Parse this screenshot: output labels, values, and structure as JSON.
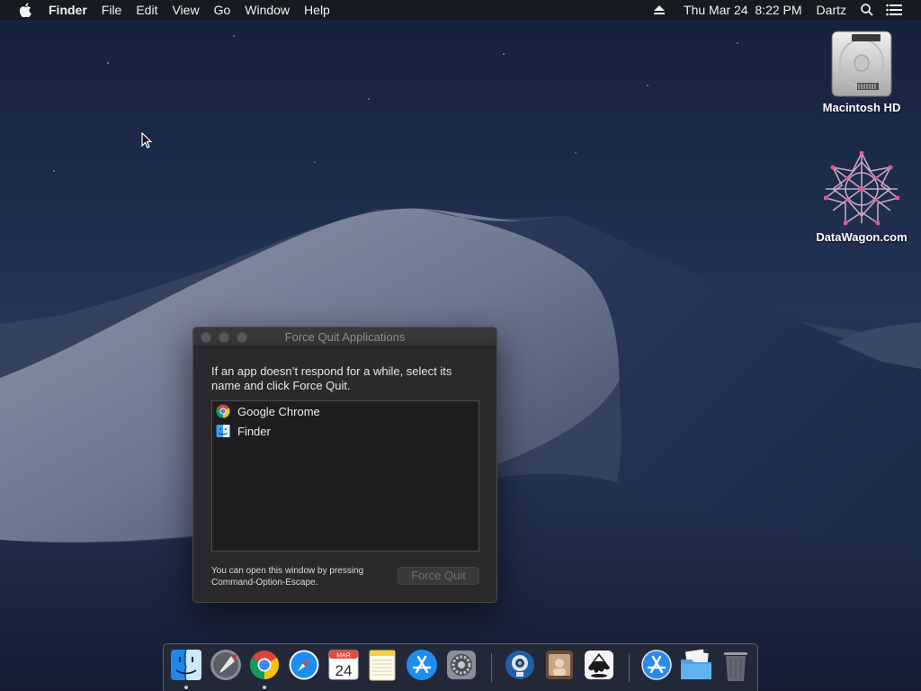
{
  "menubar": {
    "apple_icon": "apple-logo-icon",
    "app_name": "Finder",
    "menus": [
      "File",
      "Edit",
      "View",
      "Go",
      "Window",
      "Help"
    ],
    "status": {
      "eject_icon": "eject-icon",
      "clock": "Thu Mar 24  8:22 PM",
      "user": "Dartz",
      "spotlight_icon": "search-icon",
      "notification_icon": "list-icon"
    }
  },
  "desktop": {
    "icons": [
      {
        "label": "Macintosh HD",
        "icon": "hard-drive-icon"
      },
      {
        "label": "DataWagon.com",
        "icon": "star-polygon-icon"
      }
    ]
  },
  "force_quit": {
    "title": "Force Quit Applications",
    "message": "If an app doesn’t respond for a while, select its name and click Force Quit.",
    "apps": [
      {
        "name": "Google Chrome",
        "icon": "chrome-icon"
      },
      {
        "name": "Finder",
        "icon": "finder-icon"
      }
    ],
    "hint": "You can open this window by pressing Command-Option-Escape.",
    "button_label": "Force Quit",
    "button_enabled": false
  },
  "dock": {
    "calendar_month": "MAR",
    "calendar_day": "24",
    "items": [
      {
        "name": "finder-icon",
        "running": true
      },
      {
        "name": "launchpad-icon",
        "running": false
      },
      {
        "name": "chrome-icon",
        "running": true
      },
      {
        "name": "safari-icon",
        "running": false
      },
      {
        "name": "calendar-icon",
        "running": false
      },
      {
        "name": "notes-icon",
        "running": false
      },
      {
        "name": "app-store-icon",
        "running": false
      },
      {
        "name": "system-preferences-icon",
        "running": false
      },
      {
        "name": "webcam-icon",
        "running": false
      },
      {
        "name": "photo-booth-icon",
        "running": false
      },
      {
        "name": "inkscape-icon",
        "running": false
      },
      {
        "name": "applications-folder-icon",
        "running": false
      },
      {
        "name": "documents-folder-icon",
        "running": false
      },
      {
        "name": "trash-icon",
        "running": false
      }
    ]
  },
  "colors": {
    "menubar_bg": "#181a20",
    "window_bg": "#2a2a2c",
    "list_bg": "#1e1e20",
    "sky_top": "#1a2440",
    "dune_light": "#7e889e"
  }
}
